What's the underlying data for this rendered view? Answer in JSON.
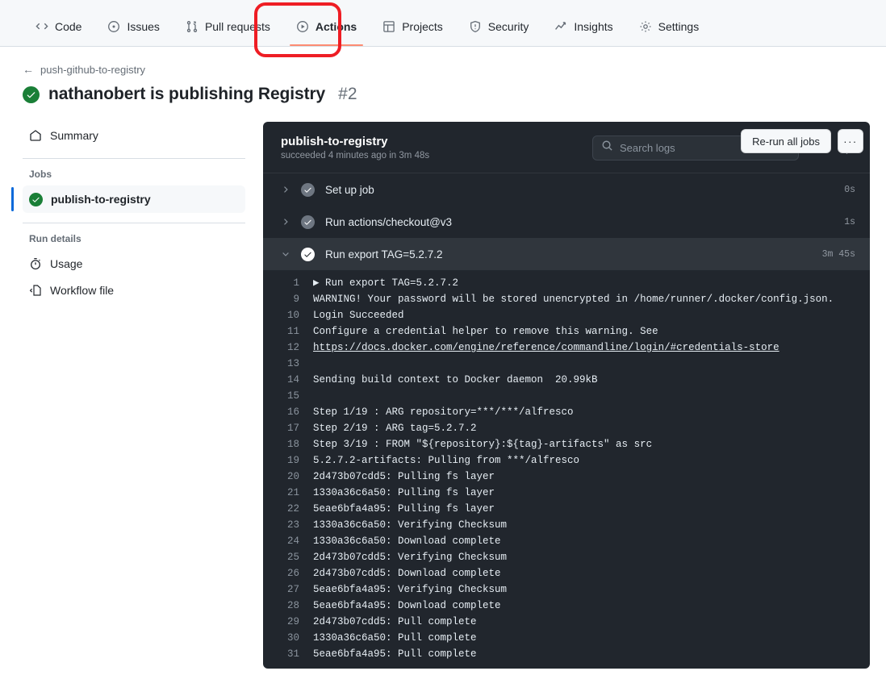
{
  "repo_nav": {
    "items": [
      {
        "label": "Code",
        "icon": "code-icon",
        "active": false
      },
      {
        "label": "Issues",
        "icon": "issue-opened-icon",
        "active": false
      },
      {
        "label": "Pull requests",
        "icon": "git-pull-request-icon",
        "active": false
      },
      {
        "label": "Actions",
        "icon": "play-icon",
        "active": true
      },
      {
        "label": "Projects",
        "icon": "table-icon",
        "active": false
      },
      {
        "label": "Security",
        "icon": "shield-icon",
        "active": false
      },
      {
        "label": "Insights",
        "icon": "graph-icon",
        "active": false
      },
      {
        "label": "Settings",
        "icon": "gear-icon",
        "active": false
      }
    ]
  },
  "annotation": {
    "color": "#ee1d24",
    "target": "Actions"
  },
  "run_header": {
    "breadcrumb": "push-github-to-registry",
    "back_arrow": "←",
    "title": "nathanobert is publishing Registry",
    "run_number": "#2",
    "status": "success",
    "rerun_label": "Re-run all jobs",
    "more_label": "···"
  },
  "sidebar": {
    "summary_label": "Summary",
    "jobs_heading": "Jobs",
    "jobs": [
      {
        "label": "publish-to-registry",
        "status": "success",
        "selected": true
      }
    ],
    "run_details_heading": "Run details",
    "details": [
      {
        "label": "Usage",
        "icon": "stopwatch-icon"
      },
      {
        "label": "Workflow file",
        "icon": "workflow-file-icon"
      }
    ]
  },
  "logs": {
    "job_title": "publish-to-registry",
    "job_subtitle": "succeeded 4 minutes ago in 3m 48s",
    "search_placeholder": "Search logs",
    "search_value": "",
    "refresh_icon": "refresh-icon",
    "settings_icon": "gear-icon",
    "steps": [
      {
        "label": "Set up job",
        "duration": "0s",
        "expanded": false,
        "status": "success"
      },
      {
        "label": "Run actions/checkout@v3",
        "duration": "1s",
        "expanded": false,
        "status": "success"
      },
      {
        "label": "Run export TAG=5.2.7.2",
        "duration": "3m 45s",
        "expanded": true,
        "status": "success"
      }
    ],
    "lines": [
      {
        "n": "1",
        "text": "▶ Run export TAG=5.2.7.2"
      },
      {
        "n": "9",
        "text": "WARNING! Your password will be stored unencrypted in /home/runner/.docker/config.json."
      },
      {
        "n": "10",
        "text": "Login Succeeded"
      },
      {
        "n": "11",
        "text": "Configure a credential helper to remove this warning. See"
      },
      {
        "n": "12",
        "text": "https://docs.docker.com/engine/reference/commandline/login/#credentials-store",
        "link": true
      },
      {
        "n": "13",
        "text": ""
      },
      {
        "n": "14",
        "text": "Sending build context to Docker daemon  20.99kB"
      },
      {
        "n": "15",
        "text": ""
      },
      {
        "n": "16",
        "text": "Step 1/19 : ARG repository=***/***/alfresco"
      },
      {
        "n": "17",
        "text": "Step 2/19 : ARG tag=5.2.7.2"
      },
      {
        "n": "18",
        "text": "Step 3/19 : FROM \"${repository}:${tag}-artifacts\" as src"
      },
      {
        "n": "19",
        "text": "5.2.7.2-artifacts: Pulling from ***/alfresco"
      },
      {
        "n": "20",
        "text": "2d473b07cdd5: Pulling fs layer"
      },
      {
        "n": "21",
        "text": "1330a36c6a50: Pulling fs layer"
      },
      {
        "n": "22",
        "text": "5eae6bfa4a95: Pulling fs layer"
      },
      {
        "n": "23",
        "text": "1330a36c6a50: Verifying Checksum"
      },
      {
        "n": "24",
        "text": "1330a36c6a50: Download complete"
      },
      {
        "n": "25",
        "text": "2d473b07cdd5: Verifying Checksum"
      },
      {
        "n": "26",
        "text": "2d473b07cdd5: Download complete"
      },
      {
        "n": "27",
        "text": "5eae6bfa4a95: Verifying Checksum"
      },
      {
        "n": "28",
        "text": "5eae6bfa4a95: Download complete"
      },
      {
        "n": "29",
        "text": "2d473b07cdd5: Pull complete"
      },
      {
        "n": "30",
        "text": "1330a36c6a50: Pull complete"
      },
      {
        "n": "31",
        "text": "5eae6bfa4a95: Pull complete"
      }
    ]
  },
  "colors": {
    "accent_blue": "#0969da",
    "success_green": "#1a7f37",
    "active_tab_underline": "#fd8c73",
    "annotation_red": "#ee1d24",
    "log_bg": "#21262d"
  }
}
